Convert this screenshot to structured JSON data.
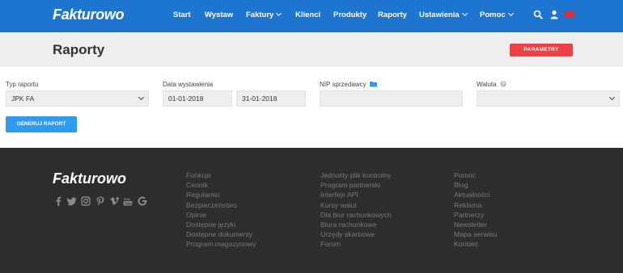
{
  "header": {
    "logo": "Fakturowo",
    "nav": [
      "Start",
      "Wystaw",
      "Faktury",
      "Klienci",
      "Produkty",
      "Raporty",
      "Ustawienia",
      "Pomoc"
    ],
    "accent": "#1d75cf"
  },
  "titlebar": {
    "title": "Raporty",
    "params_label": "PARAMETRY"
  },
  "form": {
    "report_type_label": "Typ raportu",
    "report_type_value": "JPK FA",
    "issue_date_label": "Data wystawienia",
    "date_from": "01-01-2018",
    "date_to": "31-01-2018",
    "nip_label": "NIP sprzedawcy",
    "nip_value": "",
    "currency_label": "Waluta",
    "currency_value": "",
    "generate_label": "GENERUJ RAPORT"
  },
  "footer": {
    "logo": "Fakturowo",
    "social_icons": [
      "facebook-icon",
      "twitter-icon",
      "instagram-icon",
      "pinterest-icon",
      "vimeo-icon",
      "youtube-icon",
      "google-icon"
    ],
    "col1": [
      "Funkcje",
      "Cennik",
      "Regulamin",
      "Bezpieczeństwo",
      "Opinie",
      "Dostępne języki",
      "Dostępne dokumenty",
      "Program magazynowy"
    ],
    "col2": [
      "Jednolity plik kontrolny",
      "Program partnerski",
      "Interfejs API",
      "Kursy walut",
      "Dla biur rachunkowych",
      "Biura rachunkowe",
      "Urzędy skarbowe",
      "Forum"
    ],
    "col3": [
      "Pomoc",
      "Blog",
      "Aktualności",
      "Reklama",
      "Partnerzy",
      "Newsletter",
      "Mapa serwisu",
      "Kontakt"
    ]
  }
}
